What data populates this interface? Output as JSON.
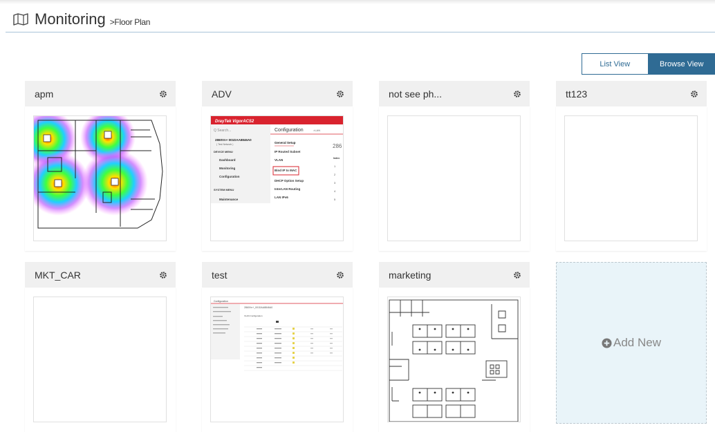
{
  "header": {
    "title": "Monitoring",
    "breadcrumb": ">Floor Plan",
    "icon": "map-icon"
  },
  "view_toggle": {
    "list_label": "List View",
    "browse_label": "Browse View",
    "active": "browse",
    "accent": "#2f6b94"
  },
  "cards": [
    {
      "name": "apm",
      "thumb": "heatmap-floorplan"
    },
    {
      "name": "ADV",
      "thumb": "configuration-screenshot"
    },
    {
      "name": "not see ph...",
      "thumb": "blank"
    },
    {
      "name": "tt123",
      "thumb": "blank"
    },
    {
      "name": "MKT_CAR",
      "thumb": "blank"
    },
    {
      "name": "test",
      "thumb": "configuration-table-screenshot"
    },
    {
      "name": "marketing",
      "thumb": "office-floorplan"
    }
  ],
  "add_new": {
    "label": "Add New",
    "icon": "plus-circle-icon"
  },
  "adv_thumb": {
    "brand": "DrayTek VigorACS2",
    "search_placeholder": "Q Search...",
    "page": "Configuration",
    "page_sub": ">LAN",
    "device": "2860Vn+ 001DAA8846A0",
    "device_sub": "( Test Network )",
    "device_menu": "DEVICE MENU",
    "menu": [
      "Dashboard",
      "Monitoring",
      "Configuration"
    ],
    "system_menu": "SYSTEM MENU",
    "system_items": [
      "Maintenance"
    ],
    "settings": [
      "General Setup",
      "IP Routed Subnet",
      "VLAN",
      "Bind IP to MAC",
      "DHCP Option Setup",
      "InterLAN Routing",
      "LAN IPv6"
    ],
    "big_number": "286",
    "col_header": "Index",
    "index_values": [
      "1",
      "2",
      "3",
      "4",
      "5"
    ]
  },
  "test_thumb": {
    "page": "Configuration",
    "device": "2860Vn+_001DAA8846A0",
    "section": "VLAN Configuration"
  }
}
